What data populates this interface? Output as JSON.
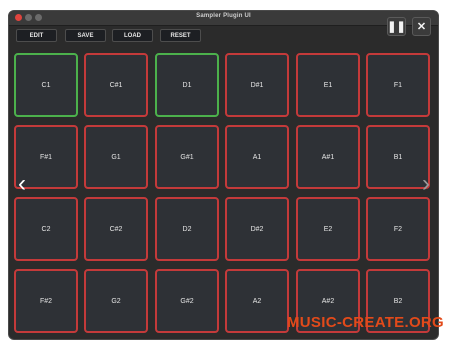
{
  "window": {
    "title": "Sampler Plugin UI"
  },
  "toolbar": {
    "edit_label": "EDIT",
    "save_label": "SAVE",
    "load_label": "LOAD",
    "reset_label": "RESET"
  },
  "controls": {
    "pause_icon": "pause-icon",
    "close_icon": "close-icon",
    "pause_glyph": "❚❚",
    "close_glyph": "✕"
  },
  "navigation": {
    "prev_glyph": "‹",
    "next_glyph": "›"
  },
  "pads": {
    "labels": [
      [
        "C1",
        "C#1",
        "D1",
        "D#1",
        "E1",
        "F1"
      ],
      [
        "F#1",
        "G1",
        "G#1",
        "A1",
        "A#1",
        "B1"
      ],
      [
        "C2",
        "C#2",
        "D2",
        "D#2",
        "E2",
        "F2"
      ],
      [
        "F#2",
        "G2",
        "G#2",
        "A2",
        "A#2",
        "B2"
      ]
    ],
    "active": [
      "C1",
      "D1"
    ]
  },
  "colors": {
    "window_bg": "#2b2b2b",
    "pad_border": "#c43a3a",
    "pad_active_border": "#4cb14c",
    "watermark": "#e24a1a"
  },
  "watermark": {
    "text": "MUSIC-CREATE.ORG"
  }
}
